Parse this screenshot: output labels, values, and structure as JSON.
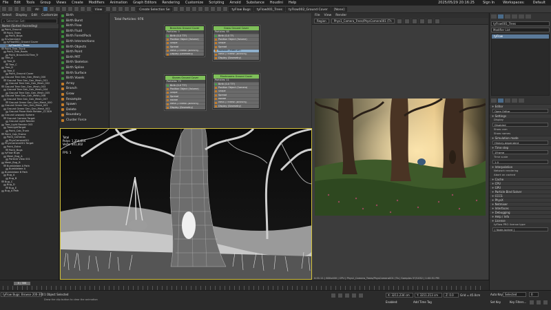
{
  "menubar": {
    "items": [
      "File",
      "Edit",
      "Tools",
      "Group",
      "Views",
      "Create",
      "Modifiers",
      "Animation",
      "Graph Editors",
      "Rendering",
      "Customize",
      "Scripting",
      "Arnold",
      "Substance",
      "Houdini",
      "Help"
    ],
    "datetime": "2025/05/29 20:16:25",
    "signin": "Sign In",
    "workspaces_label": "Workspaces:",
    "workspace": "Default"
  },
  "toolbar": {
    "selection_filter": "All",
    "create_selection_set": "Create Selection Se",
    "view_label": "View"
  },
  "top_tabs": [
    "tyFlow Bugs",
    "tyFlow001_Trees",
    "tyFlow002_Ground Cover",
    "[None]"
  ],
  "scene_explorer": {
    "tabs": [
      "Select",
      "Display",
      "Edit",
      "Customize"
    ],
    "search_placeholder": "Selection Set:",
    "header": "Name (Sorted Ascending)",
    "rows": [
      {
        "label": "Point_Ground",
        "sel": false
      },
      {
        "label": "Point_Trees",
        "sel": false
      },
      {
        "label": "Point_Bugs",
        "sel": false
      },
      {
        "label": "Environment",
        "sel": false
      },
      {
        "label": "tyFlow002_Ground Cover",
        "sel": false
      },
      {
        "label": "tyFlow001_Trees",
        "sel": true
      },
      {
        "label": "Point_Tree_Trunk",
        "sel": false
      },
      {
        "label": "Point_Tree_Roots",
        "sel": false
      },
      {
        "label": "Point_Branch002Tree_Tr",
        "sel": false
      },
      {
        "label": "Tree_A",
        "sel": false
      },
      {
        "label": "Tree_B",
        "sel": false
      },
      {
        "label": "Tree_C",
        "sel": false
      },
      {
        "label": "Tree_D",
        "sel": false
      },
      {
        "label": "Tree_E",
        "sel": false
      },
      {
        "label": "Point_Ground Cover",
        "sel": false
      },
      {
        "label": "Ground Tree Gen_Gen_Mesh_000",
        "sel": false
      },
      {
        "label": "Ground Tree Gen_Gen_Mesh_001",
        "sel": false
      },
      {
        "label": "Ground Tree Gen_Gen_Mesh_002",
        "sel": false
      },
      {
        "label": "Ground Tree Gen_Gen_Mesh_003",
        "sel": false
      },
      {
        "label": "Ground Tree Gen_Gen_Mesh_004",
        "sel": false
      },
      {
        "label": "Ground Tree Gen_Gen_Mesh_005",
        "sel": false
      },
      {
        "label": "Ground Tree Gen_Gen_Mesh_006",
        "sel": false
      },
      {
        "label": "Ground Tree Gen_Gen_Mesh_007",
        "sel": false
      },
      {
        "label": "Ground Green Gen_Gen_Mesh_000",
        "sel": false
      },
      {
        "label": "Ground Green Gen_Gen_Mesh_001",
        "sel": false
      },
      {
        "label": "Ground Green Gen_Gen_Mesh_002",
        "sel": false
      },
      {
        "label": "Ground Plane Main Render_CC3D9",
        "sel": false
      },
      {
        "label": "Ground Lowpoly Sphere",
        "sel": false
      },
      {
        "label": "Ground Camera Target",
        "sel": false
      },
      {
        "label": "Ground Light Render",
        "sel": false
      },
      {
        "label": "Tree_Light Render 003",
        "sel": false
      },
      {
        "label": "TreeLightTarget",
        "sel": false
      },
      {
        "label": "Point_Cab_Trunk",
        "sel": false
      },
      {
        "label": "Point_Cab_Frame",
        "sel": false
      },
      {
        "label": "Point_Cameras",
        "sel": false
      },
      {
        "label": "PhysCamera001",
        "sel": false
      },
      {
        "label": "PhysCamera001.Target",
        "sel": false
      },
      {
        "label": "Point_Extra",
        "sel": false
      },
      {
        "label": "Point_Bugs",
        "sel": false
      },
      {
        "label": "tyFlow Bugs",
        "sel": false
      },
      {
        "label": "Mesh_Bug_A",
        "sel": false
      },
      {
        "label": "Particle View 001",
        "sel": false
      },
      {
        "label": "Mesh_Bug_B",
        "sel": false
      },
      {
        "label": "Bumblebee A Path",
        "sel": false
      },
      {
        "label": "Bumblebee A",
        "sel": false
      },
      {
        "label": "Bumblebee B Path",
        "sel": false
      },
      {
        "label": "Bug_A",
        "sel": false
      },
      {
        "label": "Bug_B",
        "sel": false
      },
      {
        "label": "Bug_C",
        "sel": false
      },
      {
        "label": "Bug_D",
        "sel": false
      },
      {
        "label": "Bug_E",
        "sel": false
      },
      {
        "label": "Bug_A Path",
        "sel": false
      }
    ]
  },
  "operators": [
    {
      "label": "Birth",
      "c": "g"
    },
    {
      "label": "Birth Burst",
      "c": "g"
    },
    {
      "label": "Birth Flow",
      "c": "g"
    },
    {
      "label": "Birth Fluid",
      "c": "g"
    },
    {
      "label": "Birth ForestPack",
      "c": "g"
    },
    {
      "label": "Birth Intersections",
      "c": "g"
    },
    {
      "label": "Birth Objects",
      "c": "g"
    },
    {
      "label": "Birth Point",
      "c": "g"
    },
    {
      "label": "Birth PRT",
      "c": "g"
    },
    {
      "label": "Birth Skeleton",
      "c": "g"
    },
    {
      "label": "Birth Spline",
      "c": "g"
    },
    {
      "label": "Birth Surface",
      "c": "g"
    },
    {
      "label": "Birth Voxels",
      "c": "g"
    },
    {
      "label": "Array",
      "c": "o"
    },
    {
      "label": "Branch",
      "c": "o"
    },
    {
      "label": "Grow",
      "c": "o"
    },
    {
      "label": "Resample",
      "c": "o"
    },
    {
      "label": "Spawn",
      "c": "o"
    },
    {
      "label": "Delete",
      "c": "o"
    },
    {
      "label": "Boundary",
      "c": "o"
    },
    {
      "label": "Cluster Force",
      "c": "o"
    }
  ],
  "pview": {
    "title": "Total Particles: 976",
    "events": [
      {
        "header": "Branches Ground Cover",
        "sub": "Particles: 0",
        "ops": [
          "Birth (0-0 T??)",
          "Position Object (Volume)",
          "Shape",
          "Spread",
          "Mesh (TYMesh (Branch))",
          "Display (Geometry)"
        ]
      },
      {
        "header": "Grass Ground Cover",
        "sub": "Particles: 65",
        "ops": [
          "Birth (0-0 ??)",
          "Position Object (Volume)",
          "Shape",
          "Spread",
          "Rotation (Fixed Dir)",
          "Mesh (TYMesh (Branch))",
          "Display (Geometry)"
        ]
      },
      {
        "header": "Stones Ground Cover",
        "sub": "Particles: 73",
        "ops": [
          "Birth (0-0 T??)",
          "Position Object (Volume)",
          "Shape",
          "Spread",
          "Rotate",
          "Mesh (TYMesh (Branch))",
          "Display (Geometry)"
        ]
      },
      {
        "header": "Mushrooms Ground Cover",
        "sub": "Particles: 11",
        "ops": [
          "Birth (0-0 T??)",
          "Position Object (Camera)",
          "Shape",
          "Spread",
          "Rotate",
          "Mesh (TYMesh (Branch))",
          "Display (Geometry)"
        ]
      }
    ]
  },
  "viewport": {
    "label": "[+] [PhysCamera001] [Standard] [Default Shading]",
    "stats_label": "Total",
    "polys": "Polys: 1,354,614",
    "verts": "Verts: 441,002",
    "fps": "FPS: 1"
  },
  "render_frame": {
    "menu": [
      "File",
      "View",
      "Render"
    ],
    "area": "Region",
    "camera": "Phys1_Camera_Trees/PhysCamera001 (Th",
    "status": "0:01:11 | 600x400 | CPU | Phys1_Camera_Trees/PhysCamera001 (Tb | Samples 57/1032 | 1:00:51 PM"
  },
  "command_panel": {
    "object_name": "tyFlow001_Trees",
    "modifier_list": "Modifier List",
    "stack": [
      "tyFlow"
    ],
    "rollouts": [
      {
        "title": "Editor",
        "props": [
          {
            "k": "",
            "v": "Open Editor"
          }
        ]
      },
      {
        "title": "Settings",
        "props": [
          {
            "k": "Display",
            "v": "Disabled"
          },
          {
            "k": "Show cam",
            "v": ""
          },
          {
            "k": "Show names",
            "v": ""
          }
        ]
      },
      {
        "title": "Simulation mode",
        "props": [
          {
            "k": "",
            "v": "History-dependent"
          }
        ]
      },
      {
        "title": "Time step",
        "props": [
          {
            "k": "",
            "v": "1Frame"
          },
          {
            "k": "Time scale",
            "v": "1.0"
          }
        ]
      },
      {
        "title": "Interpolation",
        "props": [
          {
            "k": "Network rendering",
            "v": ""
          },
          {
            "k": "Abort on cached",
            "v": ""
          }
        ]
      },
      {
        "title": "Cache",
        "props": []
      },
      {
        "title": "CPU",
        "props": []
      },
      {
        "title": "GPU",
        "props": []
      },
      {
        "title": "Particle Bind Solver",
        "props": []
      },
      {
        "title": "CCCS",
        "props": []
      },
      {
        "title": "PhysX",
        "props": []
      },
      {
        "title": "Netmixer",
        "props": []
      },
      {
        "title": "Interfaces",
        "props": []
      },
      {
        "title": "Debugging",
        "props": []
      },
      {
        "title": "Help / Info",
        "props": []
      },
      {
        "title": "License",
        "props": [
          {
            "k": "tyFlow PRO license type",
            "v": ""
          },
          {
            "k": "",
            "v": "[ Node-locked ]"
          }
        ]
      }
    ]
  },
  "statusbar": {
    "maxscript": "tyFlow Bugs: Browse 200-300",
    "selected": "1 Object Selected",
    "prompt": "Draw the clip button to clear the animation",
    "x": "X: 3211.234 cm",
    "y": "Y: 3211.213 cm",
    "z": "Z: 0.0",
    "grid": "Grid = 45.0cm",
    "enabled_label": "Enabled:",
    "addtime": "Add Time Tag",
    "autokey": "Auto Key",
    "setkey": "Set Key",
    "selected_dd": "Selected",
    "keyfilters": "Key Filters...",
    "frame": "0",
    "timeline_slider": "0 / 300"
  }
}
